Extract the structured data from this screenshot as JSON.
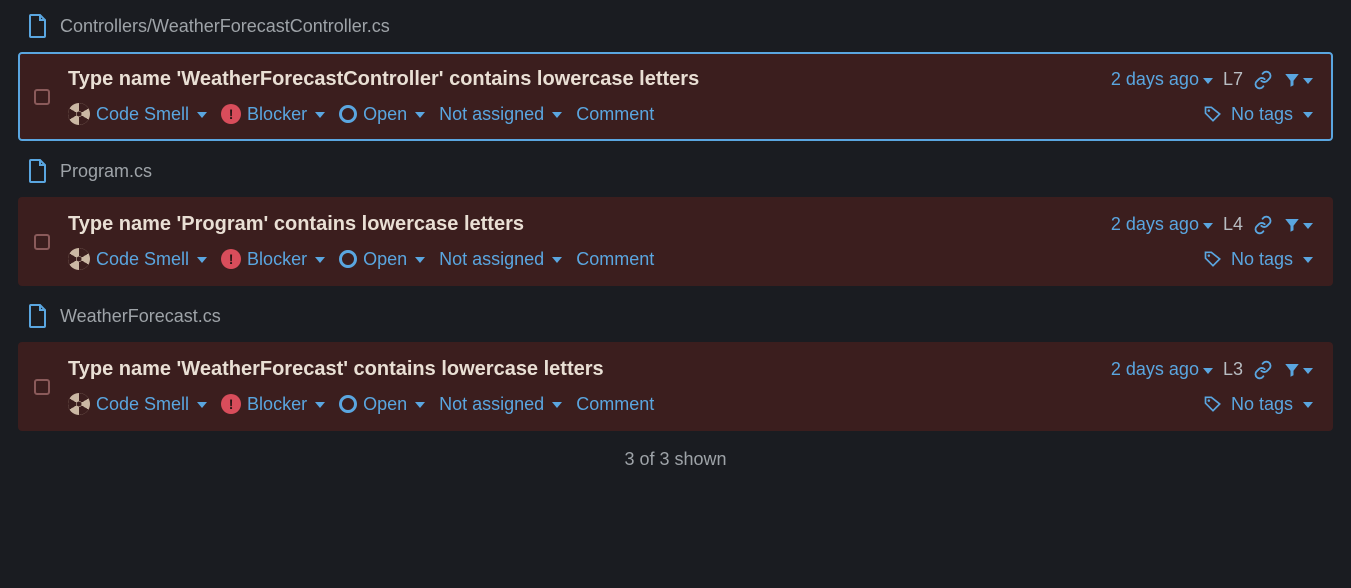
{
  "labels": {
    "code_smell": "Code Smell",
    "blocker": "Blocker",
    "open": "Open",
    "not_assigned": "Not assigned",
    "comment": "Comment",
    "no_tags": "No tags"
  },
  "footer": "3 of 3 shown",
  "groups": [
    {
      "file": "Controllers/WeatherForecastController.cs",
      "issue": {
        "title": "Type name 'WeatherForecastController' contains lowercase letters",
        "age": "2 days ago",
        "line": "L7",
        "selected": true
      }
    },
    {
      "file": "Program.cs",
      "issue": {
        "title": "Type name 'Program' contains lowercase letters",
        "age": "2 days ago",
        "line": "L4",
        "selected": false
      }
    },
    {
      "file": "WeatherForecast.cs",
      "issue": {
        "title": "Type name 'WeatherForecast' contains lowercase letters",
        "age": "2 days ago",
        "line": "L3",
        "selected": false
      }
    }
  ]
}
